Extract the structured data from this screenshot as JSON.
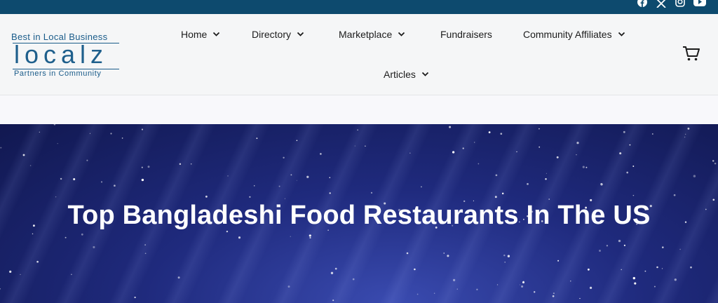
{
  "social": [
    {
      "icon": "facebook-icon"
    },
    {
      "icon": "x-twitter-icon"
    },
    {
      "icon": "instagram-icon"
    },
    {
      "icon": "youtube-icon"
    }
  ],
  "logo": {
    "tagline": "Best in Local Business",
    "wordmark": "localz",
    "subtitle": "Partners in Community"
  },
  "nav": {
    "home": "Home",
    "directory": "Directory",
    "marketplace": "Marketplace",
    "fundraisers": "Fundraisers",
    "affiliates": "Community Affiliates",
    "articles": "Articles"
  },
  "cart": {
    "icon": "cart-icon"
  },
  "hero": {
    "title": "Top Bangladeshi Food Restaurants In The US"
  },
  "colors": {
    "topbar": "#0d4a6e",
    "brand": "#1e5f8c",
    "hero_dark": "#111850",
    "hero_light": "#3a4bb0"
  }
}
